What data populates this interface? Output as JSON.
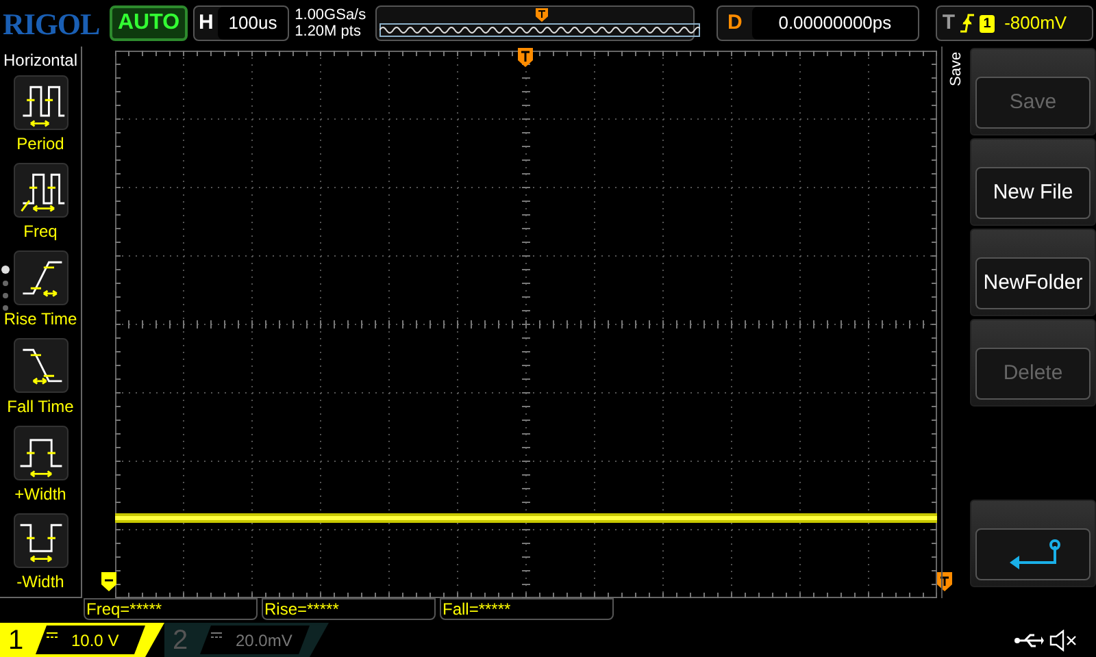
{
  "logo": "RIGOL",
  "run_state": "AUTO",
  "timebase": {
    "label": "H",
    "value": "100us"
  },
  "sample_rate": "1.00GSa/s",
  "memory_depth": "1.20M pts",
  "delay": {
    "label": "D",
    "value": "0.00000000ps"
  },
  "trigger": {
    "label": "T",
    "source": "1",
    "level": "-800mV"
  },
  "menu": {
    "title": "Horizontal",
    "items": [
      {
        "label": "Period",
        "kind": "period"
      },
      {
        "label": "Freq",
        "kind": "freq"
      },
      {
        "label": "Rise Time",
        "kind": "rise"
      },
      {
        "label": "Fall Time",
        "kind": "fall"
      },
      {
        "label": "+Width",
        "kind": "pwidth"
      },
      {
        "label": "-Width",
        "kind": "nwidth"
      }
    ],
    "pages": [
      {
        "selected": true
      },
      {
        "selected": false
      },
      {
        "selected": false
      },
      {
        "selected": false
      }
    ]
  },
  "softkeys": {
    "title": "Save",
    "buttons": [
      {
        "kind": "text",
        "label": "Save",
        "disabled": true
      },
      {
        "kind": "text",
        "label": "New File",
        "disabled": false
      },
      {
        "kind": "text",
        "label": "NewFolder",
        "disabled": false
      },
      {
        "kind": "text",
        "label": "Delete",
        "disabled": true
      },
      {
        "kind": "back"
      }
    ]
  },
  "measurements": [
    "Freq=*****",
    "Rise=*****",
    "Fall=*****"
  ],
  "channels": [
    {
      "number": "1",
      "scale": "10.0 V",
      "on": true
    },
    {
      "number": "2",
      "scale": "20.0mV",
      "on": false
    }
  ]
}
